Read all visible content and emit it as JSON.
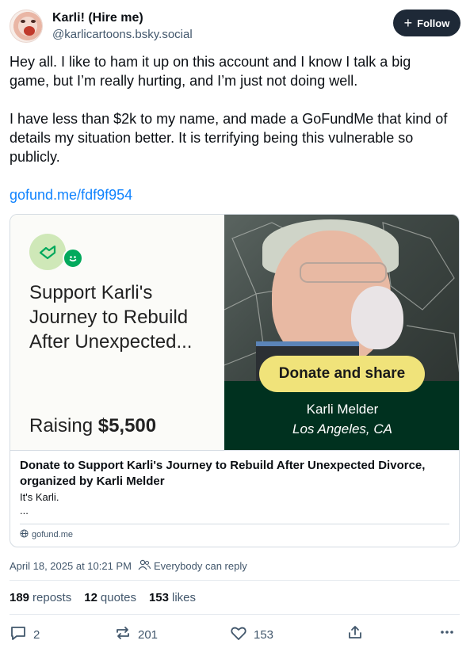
{
  "author": {
    "display_name": "Karli! (Hire me)",
    "handle": "@karlicartoons.bsky.social"
  },
  "follow_label": "Follow",
  "post": {
    "paragraph1": "Hey all. I like to ham it up on this account and I know I talk a big game, but I’m really hurting, and I’m just not doing well.",
    "paragraph2": "I have less than $2k to my name, and made a GoFundMe that kind of details my situation better. It is terrifying being this vulnerable so publicly.",
    "link_text": "gofund.me/fdf9f954"
  },
  "embed": {
    "campaign_title": "Support Karli's Journey to Rebuild After Unexpected...",
    "raising_prefix": "Raising",
    "raising_amount": "$5,500",
    "donate_button": "Donate and share",
    "organizer_name": "Karli Melder",
    "location": "Los Angeles, CA",
    "title": "Donate to Support Karli's Journey to Rebuild After Unexpected Divorce, organized by Karli Melder",
    "description": "It's Karli.",
    "ellipsis": "...",
    "domain": "gofund.me"
  },
  "meta": {
    "timestamp": "April 18, 2025 at 10:21 PM",
    "reply_setting": "Everybody can reply"
  },
  "stats": {
    "reposts_count": "189",
    "reposts_label": "reposts",
    "quotes_count": "12",
    "quotes_label": "quotes",
    "likes_count": "153",
    "likes_label": "likes"
  },
  "actions": {
    "reply_count": "2",
    "repost_count": "201",
    "like_count": "153"
  },
  "icons": {
    "reply": "speech-bubble-icon",
    "repost": "repost-arrows-icon",
    "like": "heart-icon",
    "share": "share-icon",
    "more": "ellipsis-icon",
    "follow": "plus-icon",
    "people": "people-icon",
    "globe": "globe-icon"
  },
  "colors": {
    "link": "#1083fe",
    "follow_bg": "#1e2937",
    "donate_bg": "#f0e37a",
    "gofundme_green": "#00311f"
  }
}
